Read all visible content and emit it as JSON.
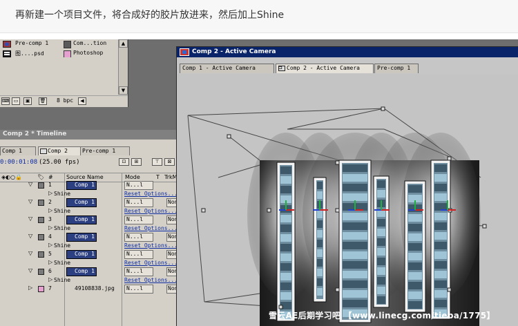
{
  "caption": "再新建一个项目文件，将合成好的胶片放进来，然后加上Shine",
  "project": {
    "items": [
      {
        "name": "Pre-comp 1",
        "swatch": "#5a5a5a",
        "type": "Com...tion"
      },
      {
        "name": "图....psd",
        "swatch": "#e6a0d0",
        "type": "Photoshop"
      }
    ],
    "bpc": "8 bpc"
  },
  "timeline": {
    "title": "Comp 2 * Timeline",
    "tabs": [
      "Comp 1",
      "Comp 2",
      "Pre-comp 1"
    ],
    "time": "0:00:01:08",
    "fps": "(25.00 fps)",
    "columns": {
      "num": "#",
      "source": "Source Name",
      "mode": "Mode",
      "t": "T",
      "trkmat": "TrkMat"
    },
    "layers": [
      {
        "num": "1",
        "source": "Comp 1",
        "mode": "N...l",
        "trk": "",
        "effect": "Shine",
        "reset": "Reset Options..."
      },
      {
        "num": "2",
        "source": "Comp 1",
        "mode": "N...l",
        "trk": "Non",
        "effect": "Shine",
        "reset": "Reset Options..."
      },
      {
        "num": "3",
        "source": "Comp 1",
        "mode": "N...l",
        "trk": "Non",
        "effect": "Shine",
        "reset": "Reset Options..."
      },
      {
        "num": "4",
        "source": "Comp 1",
        "mode": "N...l",
        "trk": "Non",
        "effect": "Shine",
        "reset": "Reset Options..."
      },
      {
        "num": "5",
        "source": "Comp 1",
        "mode": "N...l",
        "trk": "Non",
        "effect": "Shine",
        "reset": "Reset Options..."
      },
      {
        "num": "6",
        "source": "Comp 1",
        "mode": "N...l",
        "trk": "Non",
        "effect": "Shine",
        "reset": "Reset Options..."
      }
    ],
    "last_layer": {
      "num": "7",
      "source": "49108838.jpg",
      "mode": "N...l",
      "trk": "Non"
    }
  },
  "comp_window": {
    "title": "Comp 2 - Active Camera",
    "tabs": [
      "Comp 1 - Active Camera",
      "Comp 2 - Active Camera",
      "Pre-comp 1"
    ]
  },
  "watermark": "雪云AE后期学习吧 【www.linecg.com/tieba/1775】",
  "colors": {
    "title_blue": "#0a246a",
    "panel_gray": "#d4d0c8",
    "link_blue": "#0a2aa0"
  }
}
